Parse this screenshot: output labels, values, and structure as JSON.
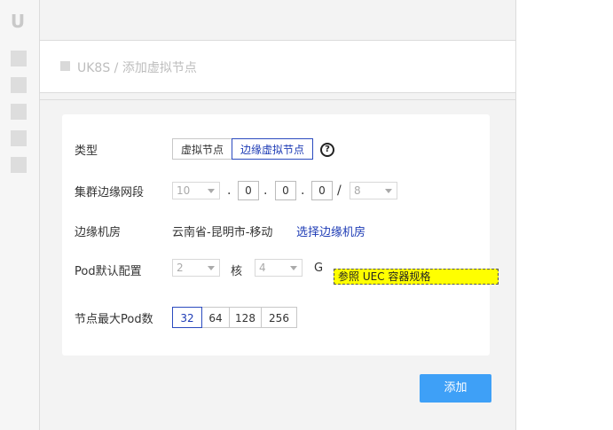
{
  "sidebar": {
    "logo": "U",
    "items": [
      "nav-1",
      "nav-2",
      "nav-3",
      "nav-4",
      "nav-5"
    ]
  },
  "breadcrumb": {
    "text": "UK8S / 添加虚拟节点"
  },
  "form": {
    "type": {
      "label": "类型",
      "options": [
        "虚拟节点",
        "边缘虚拟节点"
      ],
      "selected": "边缘虚拟节点",
      "help": "?"
    },
    "subnet": {
      "label": "集群边缘网段",
      "first_octet": "10",
      "octet2": "0",
      "octet3": "0",
      "octet4": "0",
      "dot": ".",
      "slash": "/",
      "mask": "8"
    },
    "edge_room": {
      "label": "边缘机房",
      "value": "云南省-昆明市-移动",
      "link": "选择边缘机房"
    },
    "pod_config": {
      "label": "Pod默认配置",
      "cpu": "2",
      "cpu_unit": "核",
      "mem": "4",
      "mem_unit": "G",
      "uec_hint": "参照 UEC 容器规格"
    },
    "max_pods": {
      "label": "节点最大Pod数",
      "options": [
        "32",
        "64",
        "128",
        "256"
      ],
      "selected": "32"
    }
  },
  "actions": {
    "add": "添加"
  },
  "colors": {
    "accent": "#1d3bb5",
    "button": "#3ea0f7",
    "highlight": "#ffff00"
  }
}
